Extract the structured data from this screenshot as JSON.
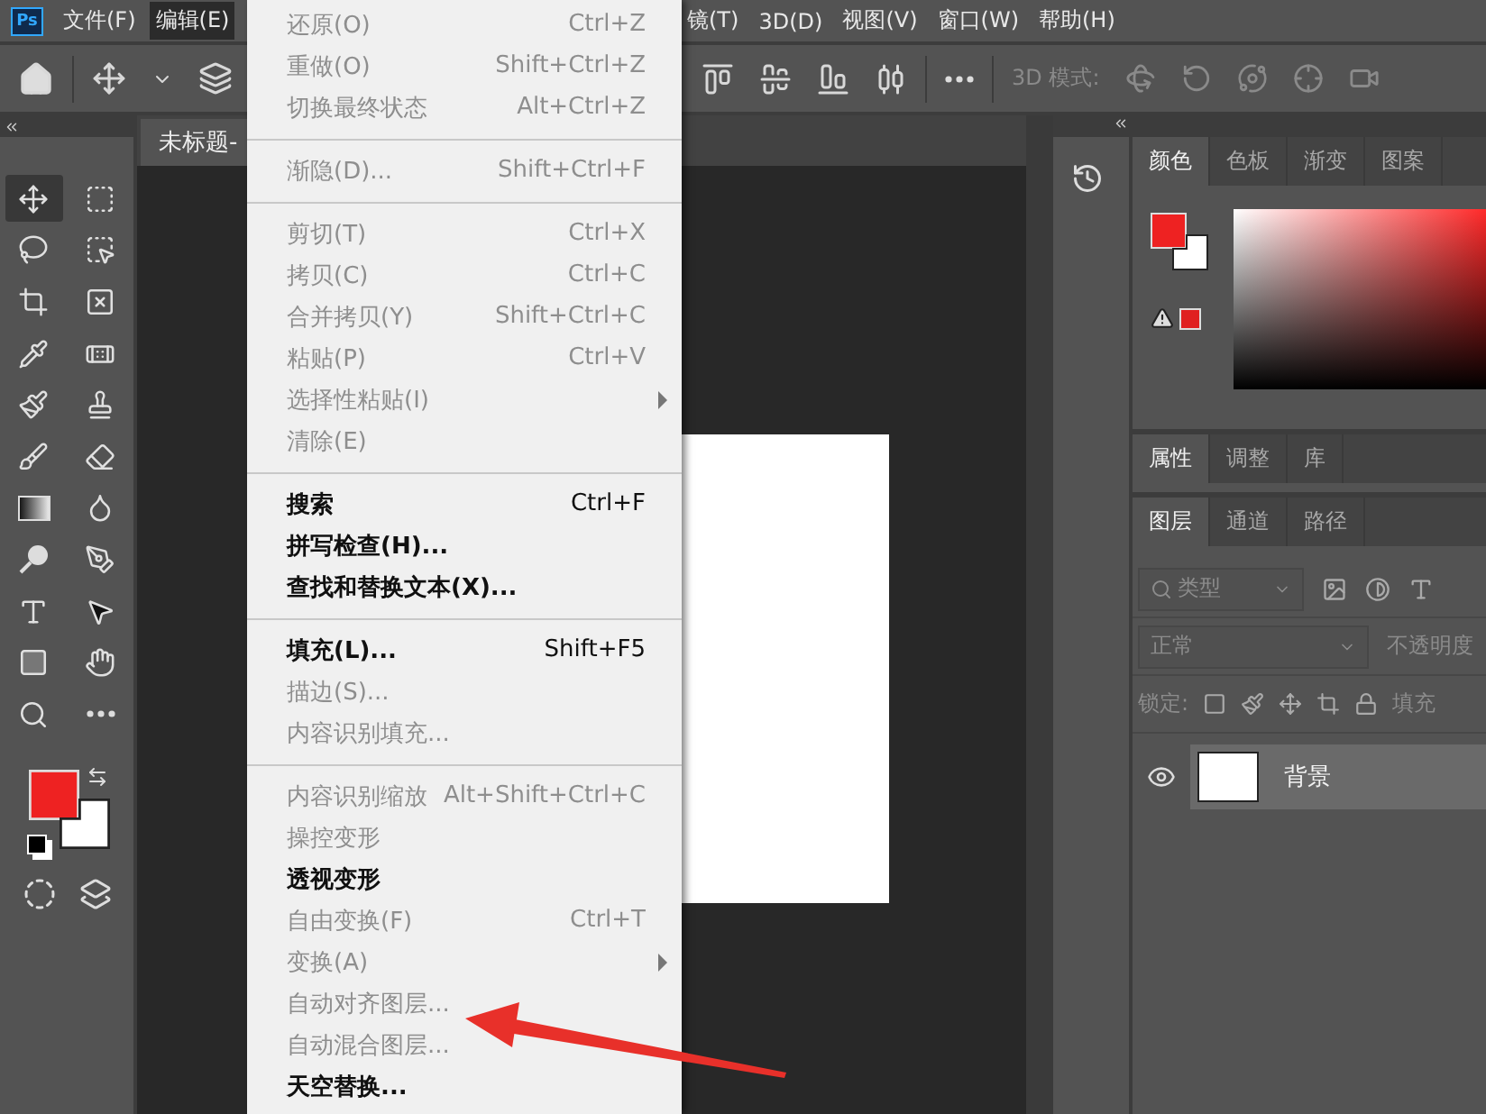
{
  "menubar": {
    "logo": "Ps",
    "items": [
      {
        "label": "文件(F)",
        "selected": false
      },
      {
        "label": "编辑(E)",
        "selected": true
      },
      {
        "label": "镜(T)",
        "selected": false
      },
      {
        "label": "3D(D)",
        "selected": false
      },
      {
        "label": "视图(V)",
        "selected": false
      },
      {
        "label": "窗口(W)",
        "selected": false
      },
      {
        "label": "帮助(H)",
        "selected": false
      }
    ]
  },
  "options_bar": {
    "mode_label": "3D 模式:"
  },
  "document": {
    "tab": "未标题-"
  },
  "tools": [
    {
      "kind": "move",
      "selected": true
    },
    {
      "kind": "marquee",
      "selected": false
    },
    {
      "kind": "lasso",
      "selected": false
    },
    {
      "kind": "objectselect",
      "selected": false
    },
    {
      "kind": "crop",
      "selected": false
    },
    {
      "kind": "frame",
      "selected": false
    },
    {
      "kind": "eyedropper",
      "selected": false
    },
    {
      "kind": "healing",
      "selected": false
    },
    {
      "kind": "brush",
      "selected": false
    },
    {
      "kind": "stamp",
      "selected": false
    },
    {
      "kind": "historybrush",
      "selected": false
    },
    {
      "kind": "eraser",
      "selected": false
    },
    {
      "kind": "gradient",
      "selected": false
    },
    {
      "kind": "blur",
      "selected": false
    },
    {
      "kind": "dodge",
      "selected": false
    },
    {
      "kind": "pen",
      "selected": false
    },
    {
      "kind": "type",
      "selected": false
    },
    {
      "kind": "pathselect",
      "selected": false
    },
    {
      "kind": "rectangle",
      "selected": false
    },
    {
      "kind": "hand",
      "selected": false
    },
    {
      "kind": "zoom",
      "selected": false
    },
    {
      "kind": "more",
      "selected": false
    }
  ],
  "edit_menu": {
    "items": [
      {
        "kind": "item",
        "label": "还原(O)",
        "shortcut": "Ctrl+Z",
        "disabled": true,
        "submenu": false
      },
      {
        "kind": "item",
        "label": "重做(O)",
        "shortcut": "Shift+Ctrl+Z",
        "disabled": true,
        "submenu": false
      },
      {
        "kind": "item",
        "label": "切换最终状态",
        "shortcut": "Alt+Ctrl+Z",
        "disabled": true,
        "submenu": false
      },
      {
        "kind": "separator"
      },
      {
        "kind": "item",
        "label": "渐隐(D)...",
        "shortcut": "Shift+Ctrl+F",
        "disabled": true,
        "submenu": false
      },
      {
        "kind": "separator"
      },
      {
        "kind": "item",
        "label": "剪切(T)",
        "shortcut": "Ctrl+X",
        "disabled": true,
        "submenu": false
      },
      {
        "kind": "item",
        "label": "拷贝(C)",
        "shortcut": "Ctrl+C",
        "disabled": true,
        "submenu": false
      },
      {
        "kind": "item",
        "label": "合并拷贝(Y)",
        "shortcut": "Shift+Ctrl+C",
        "disabled": true,
        "submenu": false
      },
      {
        "kind": "item",
        "label": "粘贴(P)",
        "shortcut": "Ctrl+V",
        "disabled": true,
        "submenu": false
      },
      {
        "kind": "item",
        "label": "选择性粘贴(I)",
        "disabled": true,
        "submenu": true
      },
      {
        "kind": "item",
        "label": "清除(E)",
        "disabled": true,
        "submenu": false
      },
      {
        "kind": "separator"
      },
      {
        "kind": "item",
        "label": "搜索",
        "shortcut": "Ctrl+F",
        "disabled": false,
        "submenu": false
      },
      {
        "kind": "item",
        "label": "拼写检查(H)...",
        "disabled": false,
        "submenu": false
      },
      {
        "kind": "item",
        "label": "查找和替换文本(X)...",
        "disabled": false,
        "submenu": false
      },
      {
        "kind": "separator"
      },
      {
        "kind": "item",
        "label": "填充(L)...",
        "shortcut": "Shift+F5",
        "disabled": false,
        "submenu": false
      },
      {
        "kind": "item",
        "label": "描边(S)...",
        "disabled": true,
        "submenu": false
      },
      {
        "kind": "item",
        "label": "内容识别填充...",
        "disabled": true,
        "submenu": false
      },
      {
        "kind": "separator"
      },
      {
        "kind": "item",
        "label": "内容识别缩放",
        "shortcut": "Alt+Shift+Ctrl+C",
        "disabled": true,
        "submenu": false
      },
      {
        "kind": "item",
        "label": "操控变形",
        "disabled": true,
        "submenu": false
      },
      {
        "kind": "item",
        "label": "透视变形",
        "disabled": false,
        "submenu": false
      },
      {
        "kind": "item",
        "label": "自由变换(F)",
        "shortcut": "Ctrl+T",
        "disabled": true,
        "submenu": false
      },
      {
        "kind": "item",
        "label": "变换(A)",
        "disabled": true,
        "submenu": true
      },
      {
        "kind": "item",
        "label": "自动对齐图层...",
        "disabled": true,
        "submenu": false
      },
      {
        "kind": "item",
        "label": "自动混合图层...",
        "disabled": true,
        "submenu": false
      },
      {
        "kind": "item",
        "label": "天空替换...",
        "disabled": false,
        "submenu": false
      }
    ]
  },
  "color_panel": {
    "tabs": [
      {
        "label": "颜色",
        "selected": true
      },
      {
        "label": "色板",
        "selected": false
      },
      {
        "label": "渐变",
        "selected": false
      },
      {
        "label": "图案",
        "selected": false
      }
    ]
  },
  "properties_panel": {
    "tabs": [
      {
        "label": "属性",
        "selected": true
      },
      {
        "label": "调整",
        "selected": false
      },
      {
        "label": "库",
        "selected": false
      }
    ]
  },
  "layers_panel": {
    "tabs": [
      {
        "label": "图层",
        "selected": true
      },
      {
        "label": "通道",
        "selected": false
      },
      {
        "label": "路径",
        "selected": false
      }
    ],
    "filter": {
      "value": "类型"
    },
    "blend_mode": "正常",
    "opacity_label": "不透明度",
    "lock_label": "锁定:",
    "fill_label": "填充",
    "layers": [
      {
        "name": "背景",
        "visible": true
      }
    ]
  }
}
